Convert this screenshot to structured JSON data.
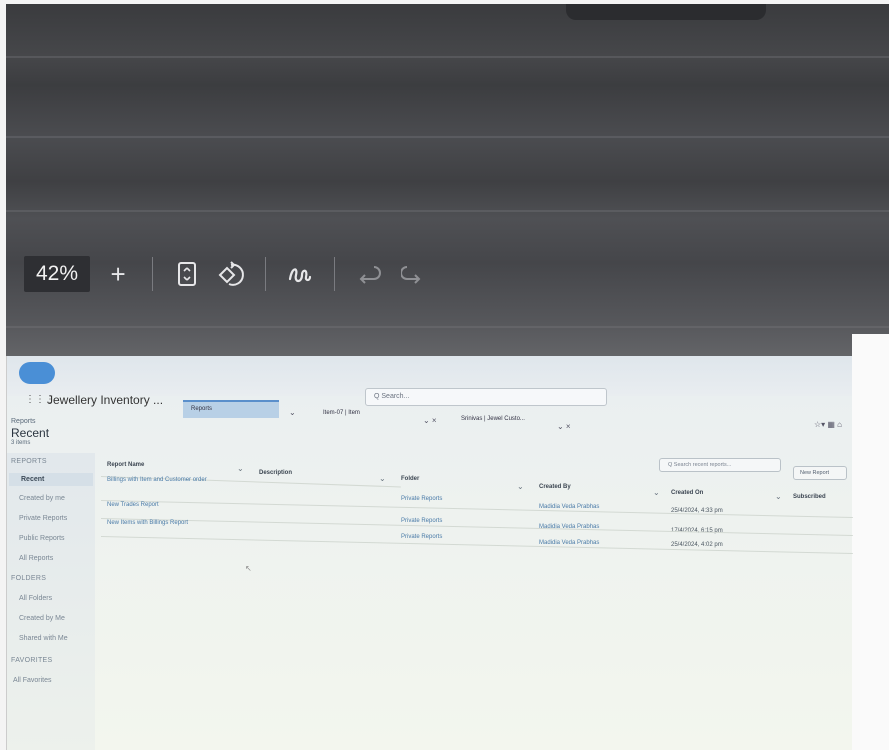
{
  "toolbar": {
    "zoom": "42%",
    "zoom_in": "+",
    "fit_icon": "fit-page-icon",
    "rotate_icon": "rotate-icon",
    "draw_icon": "draw-icon",
    "undo_icon": "undo-icon",
    "redo_icon": "redo-icon"
  },
  "app": {
    "launcher": "⋮⋮⋮",
    "name": "Jewellery Inventory ...",
    "search_placeholder": "Q Search..."
  },
  "tabs": [
    {
      "label": "Reports"
    },
    {
      "label": "Item-07 | Item"
    },
    {
      "label": "Srinivas | Jewel Custo..."
    }
  ],
  "header_icons": "☆▾  ▦ ⌂",
  "page": {
    "breadcrumb": "Reports",
    "title": "Recent",
    "count": "3 items"
  },
  "sidebar": {
    "reports_heading": "REPORTS",
    "reports_items": [
      "Recent",
      "Created by me",
      "Private Reports",
      "Public Reports",
      "All Reports"
    ],
    "folders_heading": "FOLDERS",
    "folders_items": [
      "All Folders",
      "Created by Me",
      "Shared with Me"
    ],
    "favorites_heading": "FAVORITES",
    "favorites_items": [
      "All Favorites"
    ]
  },
  "actions": {
    "search_reports_placeholder": "Q Search recent reports...",
    "new_report": "New Report"
  },
  "table": {
    "headers": [
      "Report Name",
      "Description",
      "Folder",
      "Created By",
      "Created On",
      "Subscribed"
    ],
    "rows": [
      {
        "name": "Billings with Item and Customer order",
        "description": "",
        "folder": "Private Reports",
        "created_by": "Madidia Veda Prabhas",
        "created_on": "25/4/2024, 4:33 pm"
      },
      {
        "name": "New Trades Report",
        "description": "",
        "folder": "Private Reports",
        "created_by": "Madidia Veda Prabhas",
        "created_on": "17/4/2024, 6:15 pm"
      },
      {
        "name": "New Items with Billings Report",
        "description": "",
        "folder": "Private Reports",
        "created_by": "Madidia Veda Prabhas",
        "created_on": "25/4/2024, 4:02 pm"
      }
    ]
  },
  "colors": {
    "accent": "#5a8fcb",
    "brand_cloud": "#4a8fd6"
  }
}
